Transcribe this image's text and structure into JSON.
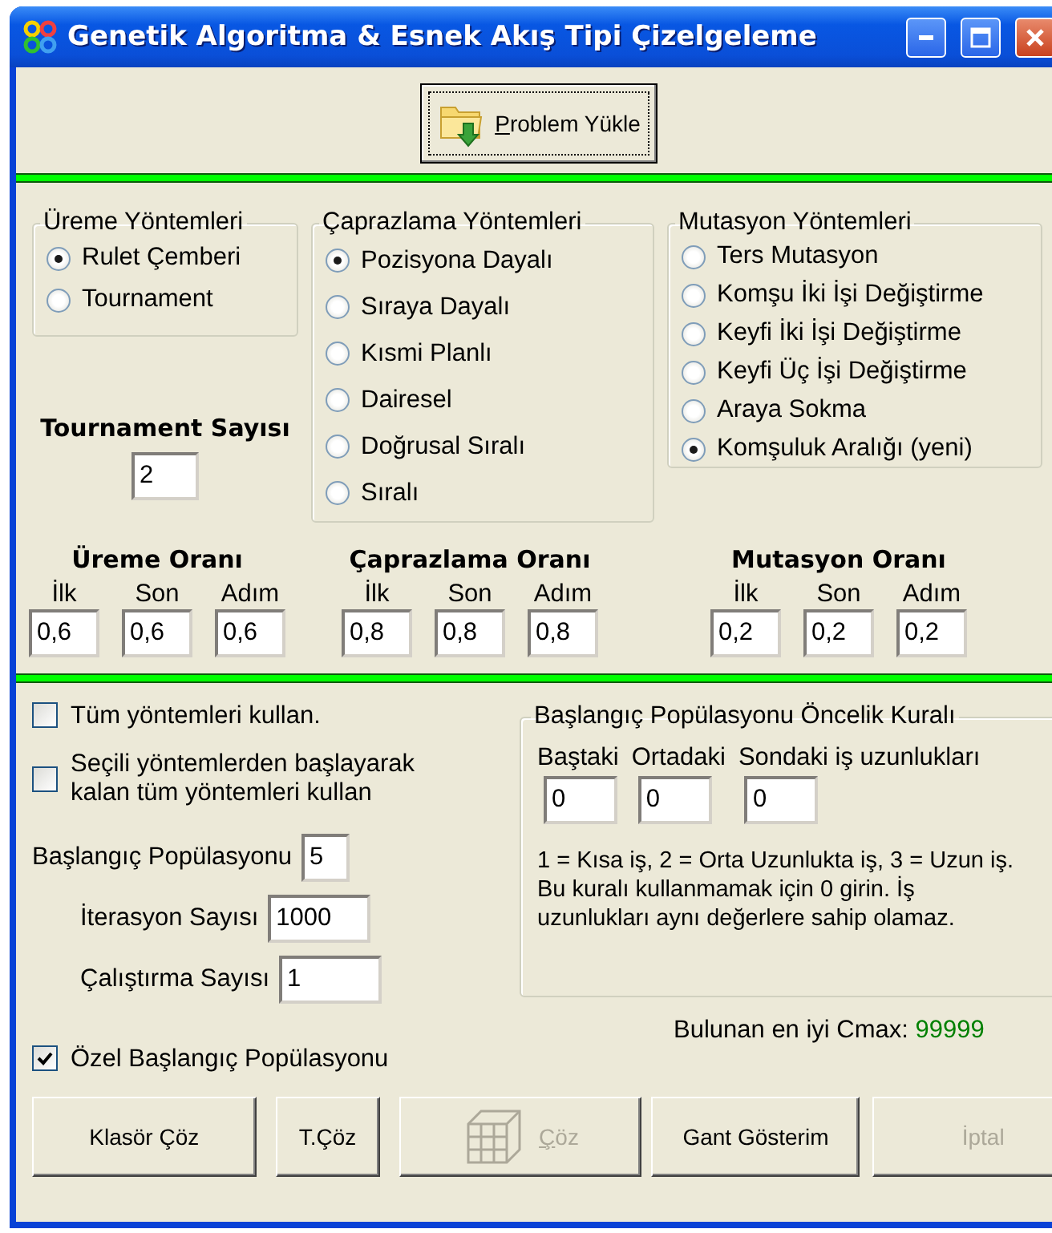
{
  "window": {
    "title": "Genetik Algoritma & Esnek Akış Tipi Çizelgeleme"
  },
  "load_button": {
    "label": "Problem Yükle",
    "mnemonic_underlined": true
  },
  "reproduction_methods": {
    "title": "Üreme Yöntemleri",
    "options": [
      {
        "label": "Rulet Çemberi",
        "selected": true
      },
      {
        "label": "Tournament",
        "selected": false
      }
    ]
  },
  "tournament": {
    "label": "Tournament Sayısı",
    "value": "2"
  },
  "crossover_methods": {
    "title": "Çaprazlama Yöntemleri",
    "options": [
      {
        "label": "Pozisyona Dayalı",
        "selected": true
      },
      {
        "label": "Sıraya Dayalı",
        "selected": false
      },
      {
        "label": "Kısmi Planlı",
        "selected": false
      },
      {
        "label": "Dairesel",
        "selected": false
      },
      {
        "label": "Doğrusal Sıralı",
        "selected": false
      },
      {
        "label": "Sıralı",
        "selected": false
      }
    ]
  },
  "mutation_methods": {
    "title": "Mutasyon Yöntemleri",
    "options": [
      {
        "label": "Ters Mutasyon",
        "selected": false
      },
      {
        "label": "Komşu İki İşi Değiştirme",
        "selected": false
      },
      {
        "label": "Keyfi İki İşi Değiştirme",
        "selected": false
      },
      {
        "label": "Keyfi Üç İşi Değiştirme",
        "selected": false
      },
      {
        "label": "Araya Sokma",
        "selected": false
      },
      {
        "label": "Komşuluk Aralığı (yeni)",
        "selected": true
      }
    ]
  },
  "rates": [
    {
      "title": "Üreme Oranı",
      "fields": [
        {
          "label": "İlk",
          "value": "0,6"
        },
        {
          "label": "Son",
          "value": "0,6"
        },
        {
          "label": "Adım",
          "value": "0,6"
        }
      ]
    },
    {
      "title": "Çaprazlama Oranı",
      "fields": [
        {
          "label": "İlk",
          "value": "0,8"
        },
        {
          "label": "Son",
          "value": "0,8"
        },
        {
          "label": "Adım",
          "value": "0,8"
        }
      ]
    },
    {
      "title": "Mutasyon Oranı",
      "fields": [
        {
          "label": "İlk",
          "value": "0,2"
        },
        {
          "label": "Son",
          "value": "0,2"
        },
        {
          "label": "Adım",
          "value": "0,2"
        }
      ]
    }
  ],
  "options": [
    {
      "label": "Tüm yöntemleri kullan.",
      "checked": false
    },
    {
      "label": "Seçili yöntemlerden başlayarak kalan tüm yöntemleri kullan",
      "checked": false
    }
  ],
  "params": [
    {
      "label": "Başlangıç Popülasyonu",
      "value": "5"
    },
    {
      "label": "İterasyon Sayısı",
      "value": "1000"
    },
    {
      "label": "Çalıştırma Sayısı",
      "value": "1"
    }
  ],
  "custom_population": {
    "label": "Özel Başlangıç Popülasyonu",
    "checked": true
  },
  "priority_rule": {
    "title": "Başlangıç Popülasyonu Öncelik Kuralı",
    "fields": [
      {
        "label": "Baştaki",
        "value": "0"
      },
      {
        "label": "Ortadaki",
        "value": "0"
      },
      {
        "label": "Sondaki iş uzunlukları",
        "value": "0"
      }
    ],
    "note": "1 = Kısa iş, 2 = Orta Uzunlukta iş, 3 = Uzun iş. Bu kuralı kullanmamak için 0 girin. İş uzunlukları aynı değerlere sahip olamaz."
  },
  "result": {
    "label": "Bulunan en iyi Cmax:",
    "value": "99999"
  },
  "buttons": [
    {
      "label": "Klasör Çöz",
      "kind": "text",
      "disabled": false
    },
    {
      "label": "T.Çöz",
      "kind": "text",
      "disabled": false
    },
    {
      "label": "Çöz",
      "kind": "icon",
      "disabled": true,
      "mnemonic_underlined": true
    },
    {
      "label": "Gant Gösterim",
      "kind": "text",
      "disabled": false
    },
    {
      "label": "İptal",
      "kind": "text",
      "disabled": true
    }
  ]
}
